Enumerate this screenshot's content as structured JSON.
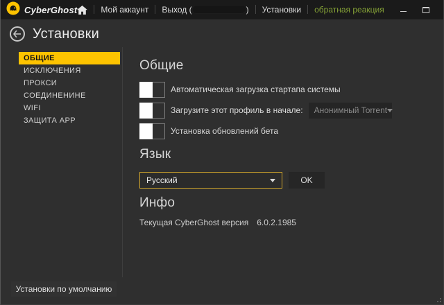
{
  "colors": {
    "accent_yellow": "#fdc300",
    "accent_green": "#84a136",
    "titlebar_bg": "#1a1a1a",
    "content_bg": "#2f2f2f",
    "language_select_border": "#d2a62b"
  },
  "titlebar": {
    "brand": "CyberGhost",
    "my_account": "Мой аккаунт",
    "logout_prefix": "Выход (",
    "logout_suffix": ")",
    "settings": "Установки",
    "feedback": "обратная реакция"
  },
  "header": {
    "title": "Установки"
  },
  "sidebar": {
    "items": [
      {
        "label": "ОБЩИЕ",
        "selected": true
      },
      {
        "label": "ИСКЛЮЧЕНИЯ",
        "selected": false
      },
      {
        "label": "ПРОКСИ",
        "selected": false
      },
      {
        "label": "СОЕДИНЕНИНЕ",
        "selected": false
      },
      {
        "label": "WIFI",
        "selected": false
      },
      {
        "label": "ЗАЩИТА APP",
        "selected": false
      }
    ],
    "defaults_button": "Установки по умолчанию"
  },
  "general": {
    "heading": "Общие",
    "toggles": [
      {
        "label": "Автоматическая загрузка стартапа системы",
        "on": false
      },
      {
        "label": "Загрузите этот профиль в начале:",
        "on": false
      },
      {
        "label": "Установка обновлений бета",
        "on": false
      }
    ],
    "profile_dropdown": {
      "value": "Анонимный Torrent",
      "disabled": true
    }
  },
  "language": {
    "heading": "Язык",
    "dropdown_value": "Русский",
    "ok_label": "OK"
  },
  "info": {
    "heading": "Инфо",
    "version_label": "Текущая CyberGhost версия",
    "version_value": "6.0.2.1985"
  }
}
